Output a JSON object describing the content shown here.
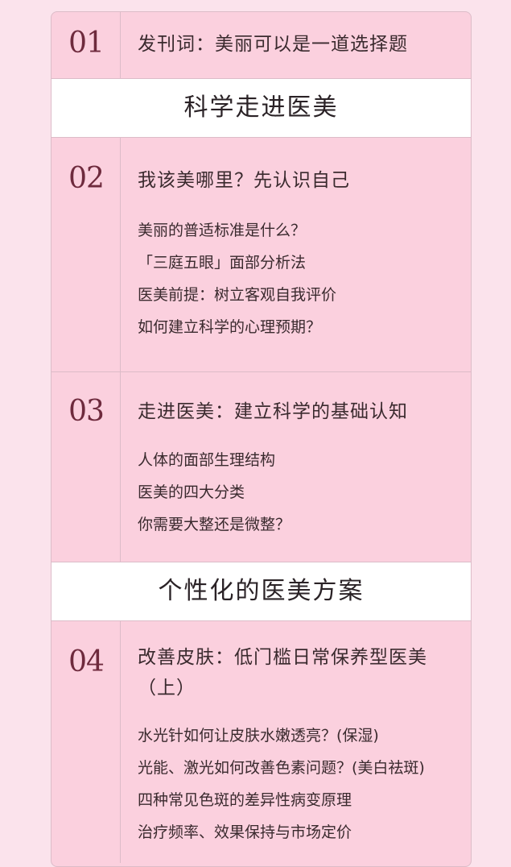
{
  "chapters": [
    {
      "num": "01",
      "title": "发刊词：美丽可以是一道选择题",
      "items": []
    },
    {
      "num": "02",
      "title": "我该美哪里？先认识自己",
      "items": [
        "美丽的普适标准是什么？",
        "「三庭五眼」面部分析法",
        "医美前提：树立客观自我评价",
        "如何建立科学的心理预期？"
      ]
    },
    {
      "num": "03",
      "title": "走进医美：建立科学的基础认知",
      "items": [
        "人体的面部生理结构",
        "医美的四大分类",
        "你需要大整还是微整？"
      ]
    },
    {
      "num": "04",
      "title": "改善皮肤：低门槛日常保养型医美（上）",
      "items": [
        "水光针如何让皮肤水嫩透亮？(保湿)",
        "光能、激光如何改善色素问题？(美白祛斑)",
        "四种常见色斑的差异性病变原理",
        "治疗频率、效果保持与市场定价"
      ]
    }
  ],
  "sections": [
    {
      "title": "科学走进医美"
    },
    {
      "title": "个性化的医美方案"
    }
  ]
}
